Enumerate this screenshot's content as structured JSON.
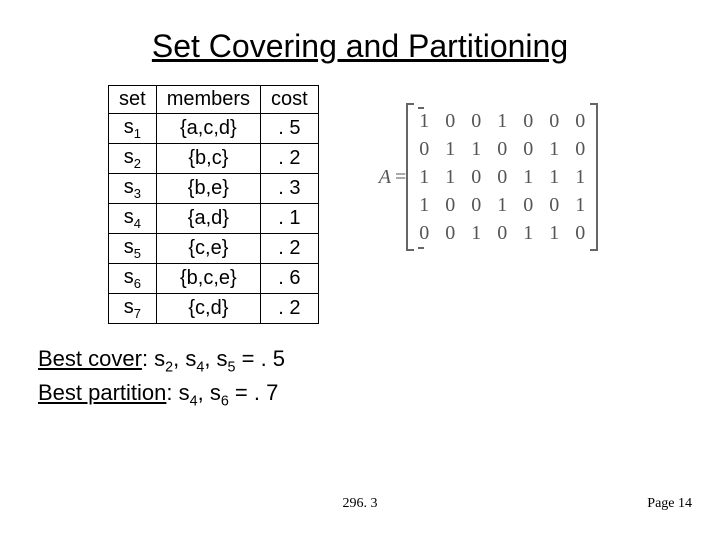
{
  "title": "Set Covering and Partitioning",
  "table": {
    "headers": [
      "set",
      "members",
      "cost"
    ],
    "rows": [
      {
        "set": "s",
        "sub": "1",
        "members": "{a,c,d}",
        "cost": ". 5"
      },
      {
        "set": "s",
        "sub": "2",
        "members": "{b,c}",
        "cost": ". 2"
      },
      {
        "set": "s",
        "sub": "3",
        "members": "{b,e}",
        "cost": ". 3"
      },
      {
        "set": "s",
        "sub": "4",
        "members": "{a,d}",
        "cost": ". 1"
      },
      {
        "set": "s",
        "sub": "5",
        "members": "{c,e}",
        "cost": ". 2"
      },
      {
        "set": "s",
        "sub": "6",
        "members": "{b,c,e}",
        "cost": ". 6"
      },
      {
        "set": "s",
        "sub": "7",
        "members": "{c,d}",
        "cost": ". 2"
      }
    ]
  },
  "matrix": {
    "label_lhs": "A",
    "eq": "=",
    "rows": [
      [
        "1",
        "0",
        "0",
        "1",
        "0",
        "0",
        "0"
      ],
      [
        "0",
        "1",
        "1",
        "0",
        "0",
        "1",
        "0"
      ],
      [
        "1",
        "1",
        "0",
        "0",
        "1",
        "1",
        "1"
      ],
      [
        "1",
        "0",
        "0",
        "1",
        "0",
        "0",
        "1"
      ],
      [
        "0",
        "0",
        "1",
        "0",
        "1",
        "1",
        "0"
      ]
    ]
  },
  "best_lines": {
    "cover_label": "Best cover",
    "cover_rest": ": s",
    "cover_a": "2",
    "cover_mid1": ", s",
    "cover_b": "4",
    "cover_mid2": ", s",
    "cover_c": "5",
    "cover_end": " = . 5",
    "part_label": "Best partition",
    "part_rest": ": s",
    "part_a": "4",
    "part_mid1": ", s",
    "part_b": "6",
    "part_end": " = . 7"
  },
  "footer": {
    "center": "296. 3",
    "right": "Page 14"
  },
  "chart_data": {
    "type": "table",
    "title": "Set Covering and Partitioning",
    "columns": [
      "set",
      "members",
      "cost"
    ],
    "rows": [
      [
        "s1",
        "{a,c,d}",
        0.5
      ],
      [
        "s2",
        "{b,c}",
        0.2
      ],
      [
        "s3",
        "{b,e}",
        0.3
      ],
      [
        "s4",
        "{a,d}",
        0.1
      ],
      [
        "s5",
        "{c,e}",
        0.2
      ],
      [
        "s6",
        "{b,c,e}",
        0.6
      ],
      [
        "s7",
        "{c,d}",
        0.2
      ]
    ],
    "matrix_A": [
      [
        1,
        0,
        0,
        1,
        0,
        0,
        0
      ],
      [
        0,
        1,
        1,
        0,
        0,
        1,
        0
      ],
      [
        1,
        1,
        0,
        0,
        1,
        1,
        1
      ],
      [
        1,
        0,
        0,
        1,
        0,
        0,
        1
      ],
      [
        0,
        0,
        1,
        0,
        1,
        1,
        0
      ]
    ],
    "best_cover": {
      "sets": [
        "s2",
        "s4",
        "s5"
      ],
      "cost": 0.5
    },
    "best_partition": {
      "sets": [
        "s4",
        "s6"
      ],
      "cost": 0.7
    }
  }
}
